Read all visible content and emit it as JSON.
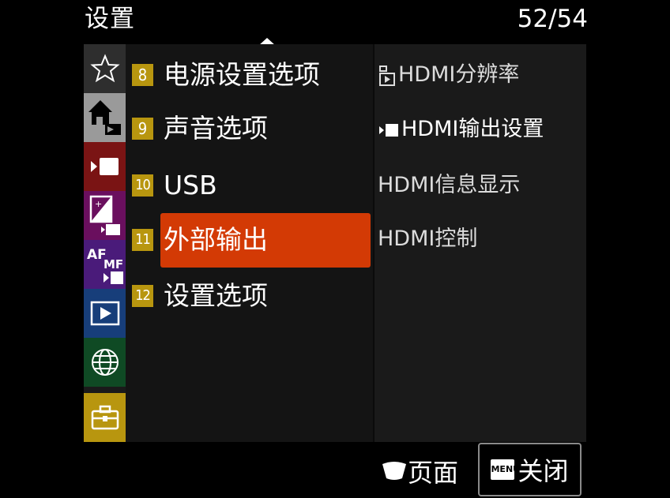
{
  "header": {
    "title": "设置",
    "page": "52/54"
  },
  "sidebar": {
    "tabs": [
      {
        "icon": "star-icon",
        "label": "",
        "color": "#2e2e2e"
      },
      {
        "icon": "home-camera-icon",
        "label": "",
        "color": "#9a9a9a",
        "selected": true
      },
      {
        "icon": "movie-icon",
        "label": "",
        "color": "#7a1414"
      },
      {
        "icon": "exposure-icon",
        "label": "",
        "color": "#6a0f5e"
      },
      {
        "icon": "af-mf-icon",
        "label": "AF MF",
        "color": "#4a1b7a"
      },
      {
        "icon": "playback-icon",
        "label": "",
        "color": "#173e7a"
      },
      {
        "icon": "globe-icon",
        "label": "",
        "color": "#0f4a24"
      },
      {
        "icon": "toolbox-icon",
        "label": "",
        "color": "#b8960f"
      }
    ]
  },
  "menu": {
    "items": [
      {
        "num": "8",
        "label": "电源设置选项"
      },
      {
        "num": "9",
        "label": "声音选项"
      },
      {
        "num": "10",
        "label": "USB"
      },
      {
        "num": "11",
        "label": "外部输出",
        "selected": true
      },
      {
        "num": "12",
        "label": "设置选项"
      }
    ]
  },
  "submenu": {
    "items": [
      {
        "icon": "photo-playback-icon",
        "label": "HDMI分辨率"
      },
      {
        "icon": "movie-record-icon",
        "label": "HDMI输出设置"
      },
      {
        "icon": "",
        "label": "HDMI信息显示"
      },
      {
        "icon": "",
        "label": "HDMI控制"
      }
    ]
  },
  "footer": {
    "page_label": "页面",
    "page_icon": "dial-icon",
    "menu_icon_text": "MENU",
    "close_label": "关闭"
  },
  "colors": {
    "highlight": "#d33a05",
    "number_badge": "#b8960f"
  }
}
